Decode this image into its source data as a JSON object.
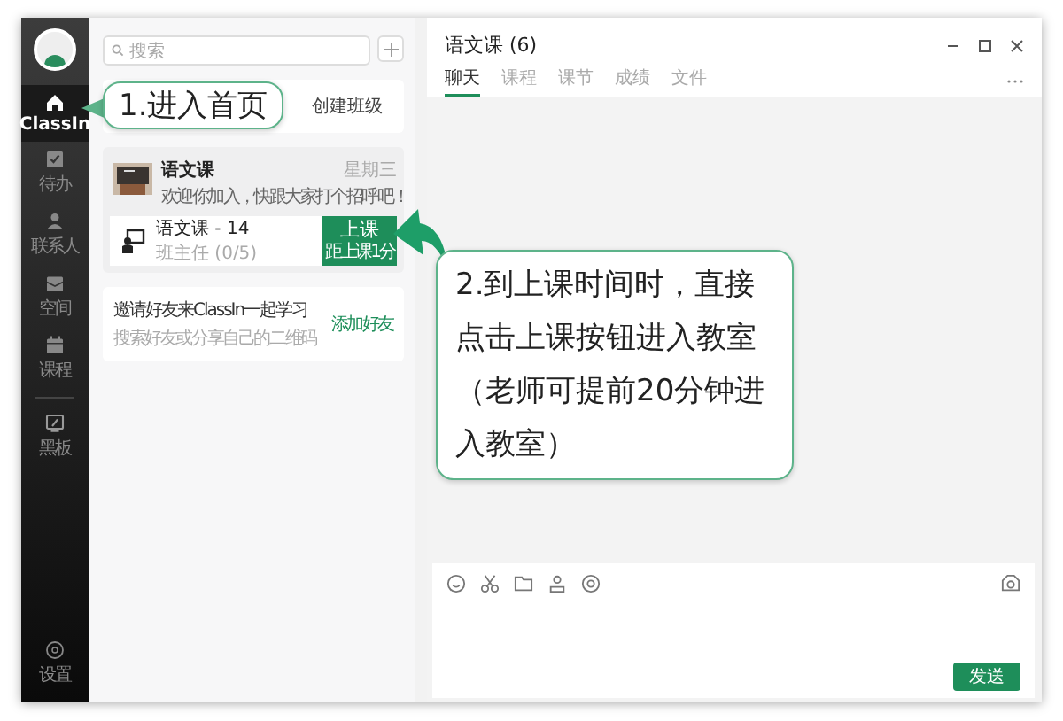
{
  "sidebar": {
    "items": [
      {
        "label": "ClassIn",
        "selected": true
      },
      {
        "label": "待办",
        "selected": false
      },
      {
        "label": "联系人",
        "selected": false
      },
      {
        "label": "空间",
        "selected": false
      },
      {
        "label": "课程",
        "selected": false
      },
      {
        "label": "黑板",
        "selected": false
      }
    ],
    "settings": "设置"
  },
  "search": {
    "placeholder": "搜索"
  },
  "create_class": "创建班级",
  "class_card": {
    "name": "语文课",
    "message": "欢迎你加入，快跟大家打个招呼吧！",
    "day": "星期三",
    "lesson": {
      "title": "语文课 - 14",
      "role": "班主任 (0/5)",
      "button": "上课",
      "countdown": "距上课1分"
    }
  },
  "invite": {
    "title": "邀请好友来ClassIn一起学习",
    "subtitle": "搜索好友或分享自己的二维码",
    "action": "添加好友"
  },
  "chat": {
    "title": "语文课 (6)",
    "tabs": [
      {
        "label": "聊天",
        "selected": true
      },
      {
        "label": "课程",
        "selected": false
      },
      {
        "label": "课节",
        "selected": false
      },
      {
        "label": "成绩",
        "selected": false
      },
      {
        "label": "文件",
        "selected": false
      }
    ],
    "send": "发送"
  },
  "callouts": [
    {
      "text": "1.进入首页"
    },
    {
      "text": "2.到上课时间时，直接点击上课按钮进入教室（老师可提前20分钟进入教室）"
    }
  ]
}
